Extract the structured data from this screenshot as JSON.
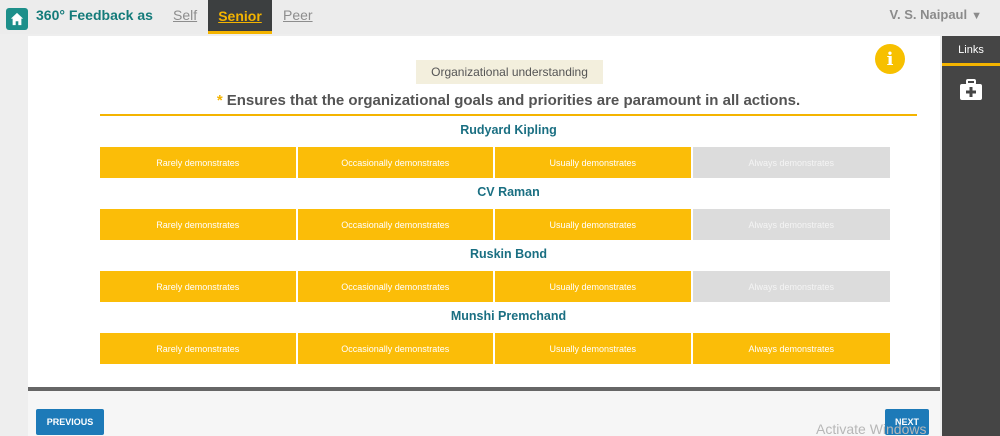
{
  "header": {
    "brand": "360° Feedback as",
    "tabs": [
      {
        "label": "Self",
        "active": false
      },
      {
        "label": "Senior",
        "active": true
      },
      {
        "label": "Peer",
        "active": false
      }
    ],
    "user": "V. S. Naipaul",
    "user_caret": "▼"
  },
  "side_panel": {
    "tab_label": "Links",
    "icon": "first-aid-kit-icon"
  },
  "question": {
    "competency": "Organizational understanding",
    "required_marker": "*",
    "statement": "Ensures that the organizational goals and priorities are paramount in all actions."
  },
  "rating_options": [
    "Rarely demonstrates",
    "Occasionally demonstrates",
    "Usually demonstrates",
    "Always demonstrates"
  ],
  "subjects": [
    {
      "name": "Rudyard Kipling",
      "selected": [
        "Rarely demonstrates",
        "Occasionally demonstrates",
        "Usually demonstrates"
      ]
    },
    {
      "name": "CV Raman",
      "selected": [
        "Rarely demonstrates",
        "Occasionally demonstrates",
        "Usually demonstrates"
      ]
    },
    {
      "name": "Ruskin Bond",
      "selected": [
        "Rarely demonstrates",
        "Occasionally demonstrates",
        "Usually demonstrates"
      ]
    },
    {
      "name": "Munshi Premchand",
      "selected": [
        "Rarely demonstrates",
        "Occasionally demonstrates",
        "Usually demonstrates",
        "Always demonstrates"
      ]
    }
  ],
  "nav": {
    "previous_label": "PREVIOUS",
    "next_label": "NEXT"
  },
  "watermark": "Activate Windows",
  "colors": {
    "accent": "#f4b400",
    "selected_option": "#fbbd08",
    "unselected_option": "#dcdcdc",
    "teal": "#147b7a",
    "button": "#1d7ab8"
  }
}
